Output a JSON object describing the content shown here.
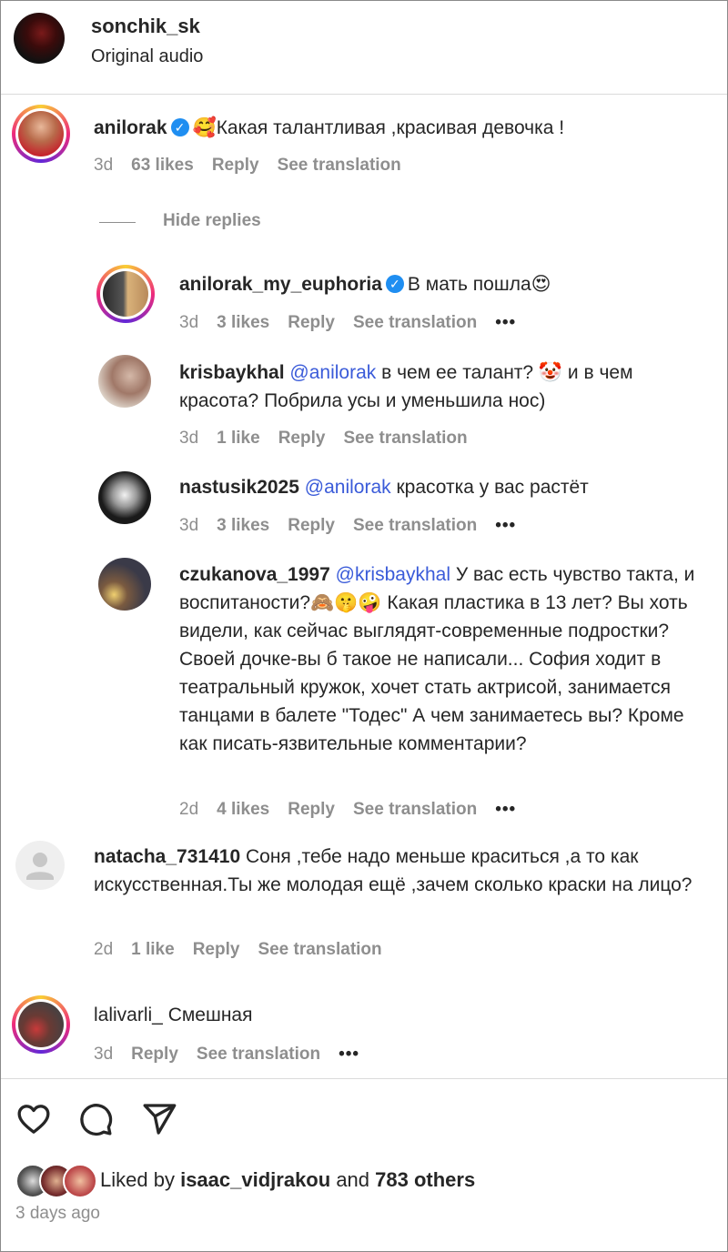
{
  "post": {
    "username": "sonchik_sk",
    "audio": "Original audio"
  },
  "comments": [
    {
      "user": "anilorak",
      "text": "🥰Какая талантливая ,красивая девочка !",
      "time": "3d",
      "likes": "63 likes",
      "reply": "Reply",
      "translate": "See translation"
    },
    {
      "user": "natacha_731410",
      "text": "Соня ,тебе надо меньше краситься ,а то как искусственная.Ты же молодая ещё ,зачем сколько краски на лицо?",
      "time": "2d",
      "likes": "1 like",
      "reply": "Reply",
      "translate": "See translation"
    },
    {
      "user": "lalivarli_",
      "text": "Смешная",
      "time": "3d",
      "reply": "Reply",
      "translate": "See translation",
      "more": "•••"
    }
  ],
  "hide_replies": "Hide replies",
  "replies": [
    {
      "user": "anilorak_my_euphoria",
      "text": "В мать пошла😍",
      "time": "3d",
      "likes": "3 likes",
      "reply": "Reply",
      "translate": "See translation",
      "more": "•••"
    },
    {
      "user": "krisbaykhal",
      "mention": "@anilorak",
      "text": "в чем ее талант? 🤡 и в чем красота? Побрила усы и уменьшила нос)",
      "time": "3d",
      "likes": "1 like",
      "reply": "Reply",
      "translate": "See translation"
    },
    {
      "user": "nastusik2025",
      "mention": "@anilorak",
      "text": "красотка у вас растёт",
      "time": "3d",
      "likes": "3 likes",
      "reply": "Reply",
      "translate": "See translation",
      "more": "•••"
    },
    {
      "user": "czukanova_1997",
      "mention": "@krisbaykhal",
      "text": "У вас есть чувство такта, и воспитаности?🙈🤫🤪 Какая пластика в 13 лет? Вы хоть видели, как сейчас выглядят-современные подростки? Своей дочке-вы б такое не написали... София ходит в театральный кружок, хочет стать актрисой, занимается танцами в балете \"Тодес\" А чем занимаетесь вы? Кроме как писать-язвительные комментарии?",
      "time": "2d",
      "likes": "4 likes",
      "reply": "Reply",
      "translate": "See translation",
      "more": "•••"
    }
  ],
  "footer": {
    "liked_prefix": "Liked by",
    "liked_user": "isaac_vidjrakou",
    "liked_and": "and",
    "liked_others": "783 others",
    "ago": "3 days ago"
  },
  "icons": [
    "heart-icon",
    "comment-icon",
    "share-icon",
    "verified-icon",
    "more-icon"
  ],
  "colors": {
    "mention": "#3a5bd9",
    "verified": "#1f8ef1",
    "muted": "#8e8e8e"
  }
}
